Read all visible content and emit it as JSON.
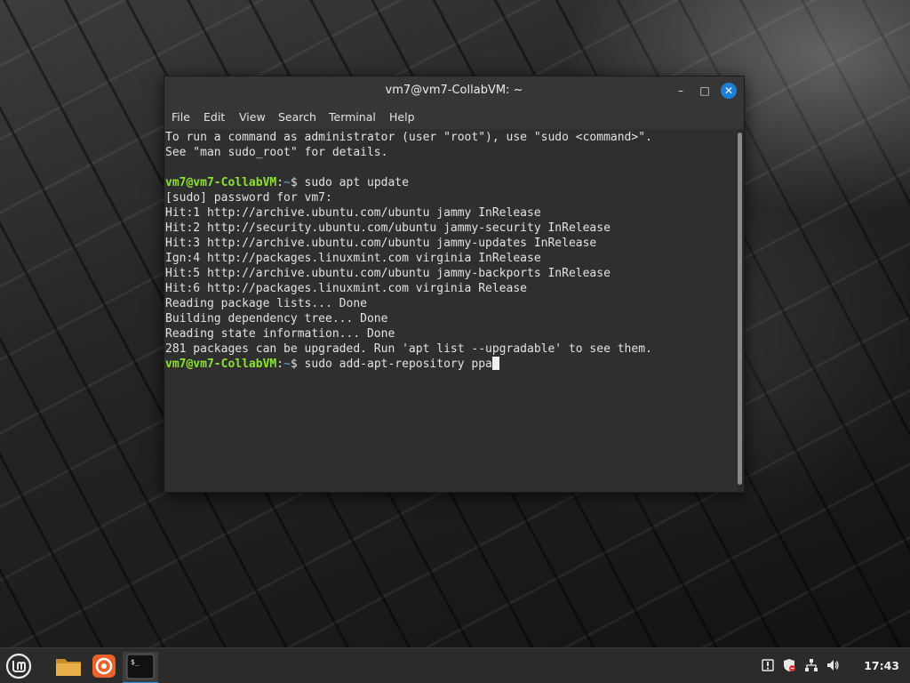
{
  "window": {
    "title": "vm7@vm7-CollabVM: ~",
    "minimize_glyph": "–",
    "maximize_glyph": "□",
    "close_glyph": "✕"
  },
  "menu": {
    "file": "File",
    "edit": "Edit",
    "view": "View",
    "search": "Search",
    "terminal": "Terminal",
    "help": "Help"
  },
  "terminal": {
    "lines": [
      {
        "type": "text",
        "text": "To run a command as administrator (user \"root\"), use \"sudo <command>\"."
      },
      {
        "type": "text",
        "text": "See \"man sudo_root\" for details."
      },
      {
        "type": "text",
        "text": ""
      },
      {
        "type": "prompt",
        "user": "vm7@vm7-CollabVM",
        "sep": ":",
        "path": "~",
        "sym": "$ ",
        "cmd": "sudo apt update"
      },
      {
        "type": "text",
        "text": "[sudo] password for vm7:"
      },
      {
        "type": "text",
        "text": "Hit:1 http://archive.ubuntu.com/ubuntu jammy InRelease"
      },
      {
        "type": "text",
        "text": "Hit:2 http://security.ubuntu.com/ubuntu jammy-security InRelease"
      },
      {
        "type": "text",
        "text": "Hit:3 http://archive.ubuntu.com/ubuntu jammy-updates InRelease"
      },
      {
        "type": "text",
        "text": "Ign:4 http://packages.linuxmint.com virginia InRelease"
      },
      {
        "type": "text",
        "text": "Hit:5 http://archive.ubuntu.com/ubuntu jammy-backports InRelease"
      },
      {
        "type": "text",
        "text": "Hit:6 http://packages.linuxmint.com virginia Release"
      },
      {
        "type": "text",
        "text": "Reading package lists... Done"
      },
      {
        "type": "text",
        "text": "Building dependency tree... Done"
      },
      {
        "type": "text",
        "text": "Reading state information... Done"
      },
      {
        "type": "text",
        "text": "281 packages can be upgraded. Run 'apt list --upgradable' to see them."
      },
      {
        "type": "prompt",
        "user": "vm7@vm7-CollabVM",
        "sep": ":",
        "path": "~",
        "sym": "$ ",
        "cmd": "sudo add-apt-repository ppa",
        "cursor": true
      }
    ]
  },
  "taskbar": {
    "terminal_icon_text": "$_",
    "clock": "17:43"
  },
  "colors": {
    "prompt_user": "#8ae234",
    "prompt_path": "#729fcf",
    "accent": "#1e7fd6",
    "folder": "#e8b04a",
    "firefox": "#e8622c"
  }
}
